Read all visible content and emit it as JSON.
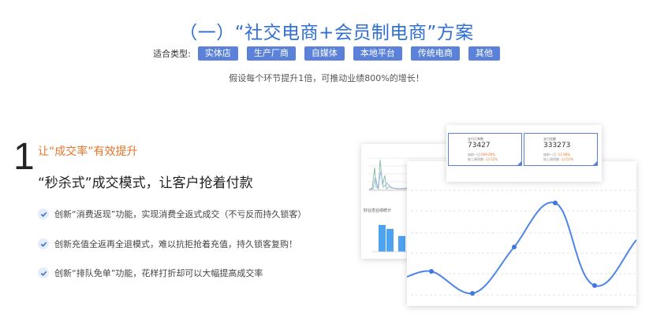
{
  "header": {
    "title": "（一）“社交电商+会员制电商”方案",
    "types_label": "适合类型:",
    "tags": [
      "实体店",
      "生产厂商",
      "自媒体",
      "本地平台",
      "传统电商",
      "其他"
    ],
    "subtitle": "假设每个环节提升1倍，可推动业绩800%的增长！"
  },
  "section": {
    "number": "1",
    "heading": "让“成交率”有效提升",
    "subheading": "“秒杀式”成交模式，让客户抢着付款",
    "features": [
      "创新“消费返现”功能，实现消费全返式成交（不亏反而持久锁客）",
      "创新充值全返再全退模式，难以抗拒抢着充值，持久锁客复购！",
      "创新“排队免单”功能，花样打折却可以大幅提高成交率"
    ]
  },
  "stats": [
    {
      "label": "支付订单数",
      "value": "73427",
      "c1": "较前一日",
      "v1": "600.00%",
      "c2": "较上周同期",
      "v2": "-13.52%"
    },
    {
      "label": "支付金额",
      "value": "333273",
      "c1": "较前一日",
      "v1": "-12.98%",
      "c2": "较上周同期",
      "v2": "-13.52%"
    }
  ],
  "bar_panel": {
    "title": "好业态业绩统计"
  },
  "colors": {
    "accent": "#2f6fd6",
    "tag": "#5b82d8",
    "orange": "#e8742a",
    "line": "#4e86e8"
  }
}
